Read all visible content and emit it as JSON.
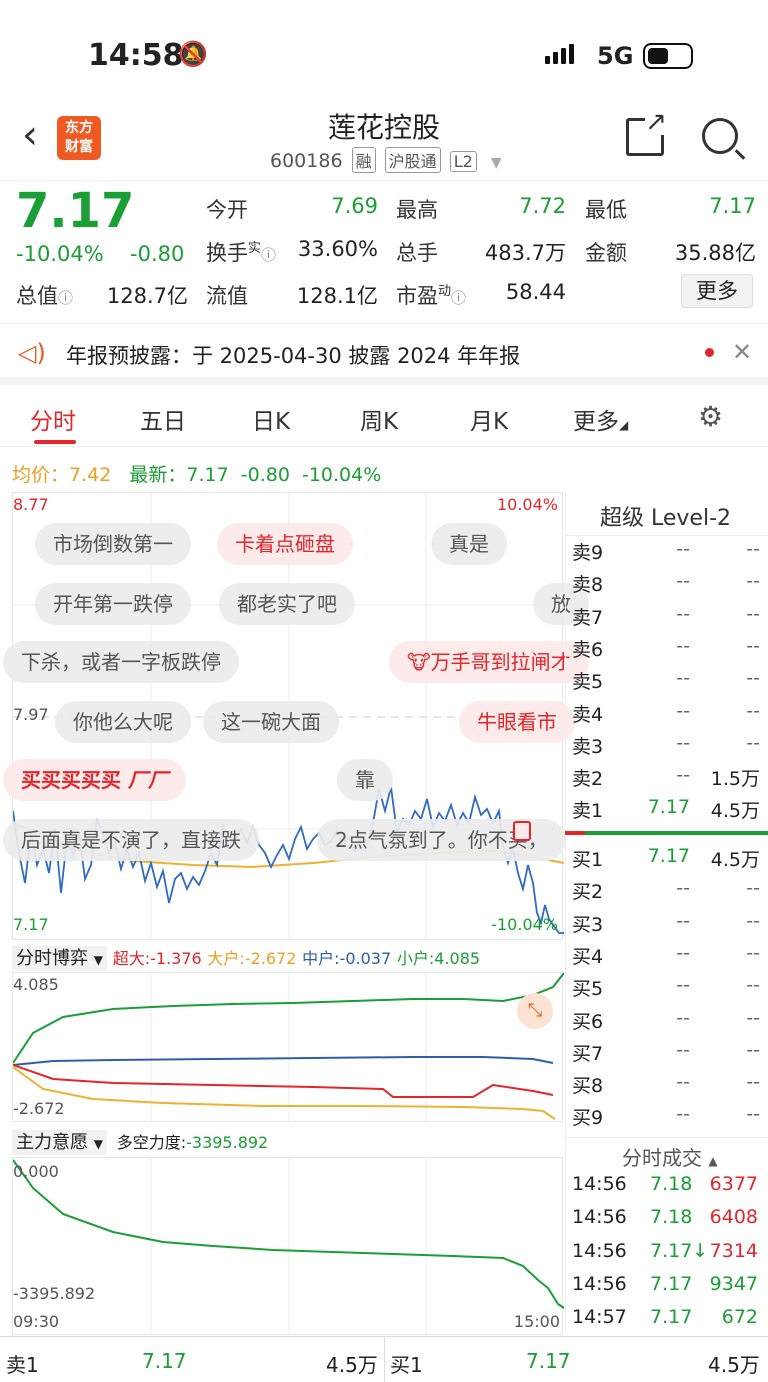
{
  "status": {
    "time": "14:58",
    "network": "5G"
  },
  "header": {
    "logo_line1": "东方",
    "logo_line2": "财富",
    "name": "莲花控股",
    "code": "600186",
    "tags": [
      "融",
      "沪股通",
      "L2"
    ]
  },
  "quote": {
    "price": "7.17",
    "change_pct": "-10.04%",
    "change": "-0.80",
    "labels": {
      "open": "今开",
      "high": "最高",
      "low": "最低",
      "turnover": "换手",
      "volume": "总手",
      "amount": "金额",
      "mktcap": "总值",
      "float": "流值",
      "pe": "市盈"
    },
    "open": "7.69",
    "high": "7.72",
    "low": "7.17",
    "turnover": "33.60%",
    "volume": "483.7万",
    "amount": "35.88亿",
    "mktcap": "128.7亿",
    "float": "128.1亿",
    "pe": "58.44",
    "more": "更多",
    "sup_real": "实",
    "sup_dyn": "动"
  },
  "notice": {
    "text": "年报预披露：于 2025-04-30 披露 2024 年年报"
  },
  "tabs": [
    "分时",
    "五日",
    "日K",
    "周K",
    "月K",
    "更多"
  ],
  "avg_row": {
    "avg_label": "均价：",
    "avg": "7.42",
    "latest_label": "最新：",
    "latest": "7.17",
    "chg": "-0.80",
    "pct": "-10.04%"
  },
  "chart": {
    "high_label": "8.77",
    "high_pct": "10.04%",
    "mid_label": "7.97",
    "low_label": "7.17",
    "low_pct": "-10.04%"
  },
  "barrage": [
    "市场倒数第一",
    "卡着点砸盘",
    "真是",
    "开年第一跌停",
    "都老实了吧",
    "放",
    "下杀，或者一字板跌停",
    "万手哥到拉闸才",
    "你他么大呢",
    "这一碗大面",
    "牛眼看市",
    "买买买买买",
    "厂厂",
    "靠",
    "后面真是不演了，直接跌",
    "2点气氛到了。你不买，"
  ],
  "flow": {
    "title": "分时博弈",
    "super_label": "超大:",
    "super": "-1.376",
    "large_label": "大户:",
    "large": "-2.672",
    "mid_label": "中户:",
    "mid": "-0.037",
    "small_label": "小户:",
    "small": "4.085",
    "ymax": "4.085",
    "ymin": "-2.672"
  },
  "will": {
    "title": "主力意愿",
    "force_label": "多空力度:",
    "force": "-3395.892",
    "ymax": "0.000",
    "ymin": "-3395.892",
    "t_start": "09:30",
    "t_end": "15:00"
  },
  "level2": {
    "title": "超级 Level-2",
    "asks": [
      {
        "l": "卖9",
        "p": "--",
        "v": "--"
      },
      {
        "l": "卖8",
        "p": "--",
        "v": "--"
      },
      {
        "l": "卖7",
        "p": "--",
        "v": "--"
      },
      {
        "l": "卖6",
        "p": "--",
        "v": "--"
      },
      {
        "l": "卖5",
        "p": "--",
        "v": "--"
      },
      {
        "l": "卖4",
        "p": "--",
        "v": "--"
      },
      {
        "l": "卖3",
        "p": "--",
        "v": "--"
      },
      {
        "l": "卖2",
        "p": "--",
        "v": "1.5万"
      },
      {
        "l": "卖1",
        "p": "7.17",
        "v": "4.5万"
      }
    ],
    "bids": [
      {
        "l": "买1",
        "p": "7.17",
        "v": "4.5万"
      },
      {
        "l": "买2",
        "p": "--",
        "v": "--"
      },
      {
        "l": "买3",
        "p": "--",
        "v": "--"
      },
      {
        "l": "买4",
        "p": "--",
        "v": "--"
      },
      {
        "l": "买5",
        "p": "--",
        "v": "--"
      },
      {
        "l": "买6",
        "p": "--",
        "v": "--"
      },
      {
        "l": "买7",
        "p": "--",
        "v": "--"
      },
      {
        "l": "买8",
        "p": "--",
        "v": "--"
      },
      {
        "l": "买9",
        "p": "--",
        "v": "--"
      }
    ],
    "trades_title": "分时成交",
    "trades": [
      {
        "t": "14:56",
        "p": "7.18",
        "v": "6377"
      },
      {
        "t": "14:56",
        "p": "7.18",
        "v": "6408"
      },
      {
        "t": "14:56",
        "p": "7.17↓",
        "v": "7314"
      },
      {
        "t": "14:56",
        "p": "7.17",
        "v": "9347"
      },
      {
        "t": "14:57",
        "p": "7.17",
        "v": "672"
      }
    ]
  },
  "footer": {
    "sell_label": "卖1",
    "sell_price": "7.17",
    "sell_vol": "4.5万",
    "buy_label": "买1",
    "buy_price": "7.17",
    "buy_vol": "4.5万"
  }
}
